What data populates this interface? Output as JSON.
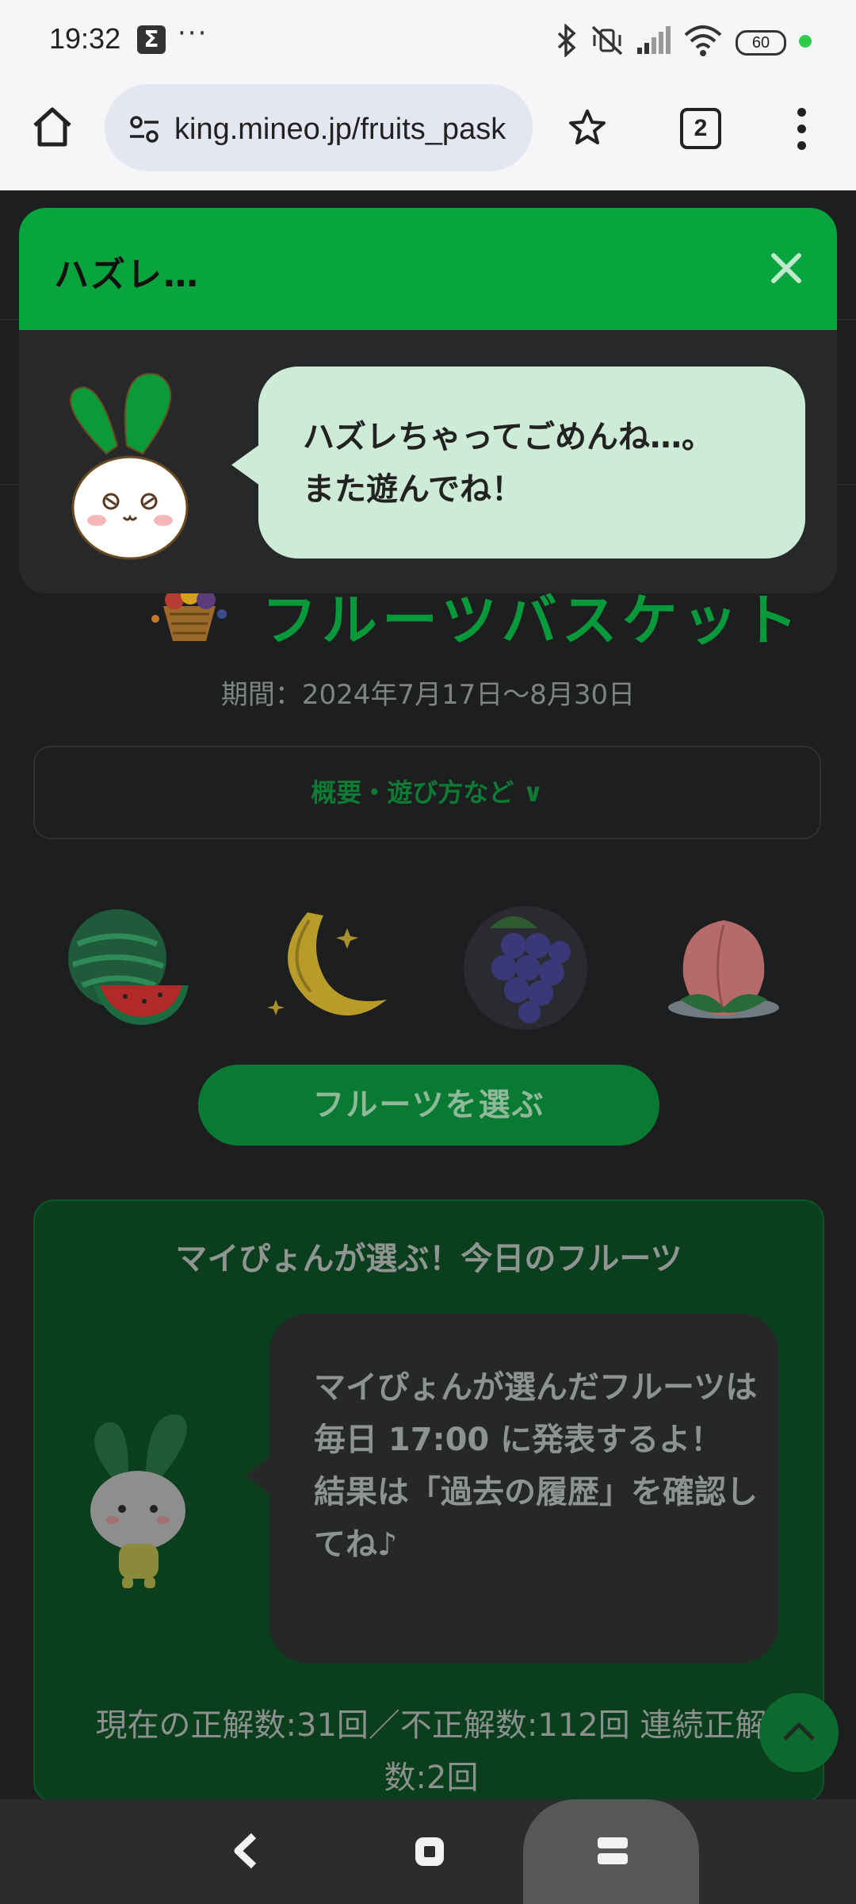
{
  "status_bar": {
    "time": "19:32",
    "sigma_icon_letter": "Σ",
    "more_dots": "···",
    "battery": "60",
    "icons": [
      "bluetooth-icon",
      "mute-vibrate-icon",
      "signal-icon",
      "wifi-icon",
      "battery-icon"
    ]
  },
  "browser": {
    "url": "king.mineo.jp/fruits_pask",
    "tab_count": "2"
  },
  "page": {
    "event_title": "フルーツバスケット",
    "period": "期間：2024年7月17日〜8月30日",
    "overview_label": "概要・遊び方など ∨",
    "fruits": [
      "watermelon",
      "banana",
      "grape",
      "peach"
    ],
    "choose_button": "フルーツを選ぶ",
    "pick_section": {
      "title": "マイぴょんが選ぶ！今日のフルーツ",
      "bubble_text": "マイぴょんが選んだフルーツは毎日 17:00 に発表するよ！\n結果は「過去の履歴」を確認してね♪",
      "stats": "現在の正解数:31回／不正解数:112回 連続正解数:2回"
    }
  },
  "dialog": {
    "title": "ハズレ…",
    "message": "ハズレちゃってごめんね…。\nまた遊んでね！"
  },
  "colors": {
    "accent_green": "#08a43e",
    "bubble_light": "#cdebd7",
    "panel_dark": "#262829"
  }
}
